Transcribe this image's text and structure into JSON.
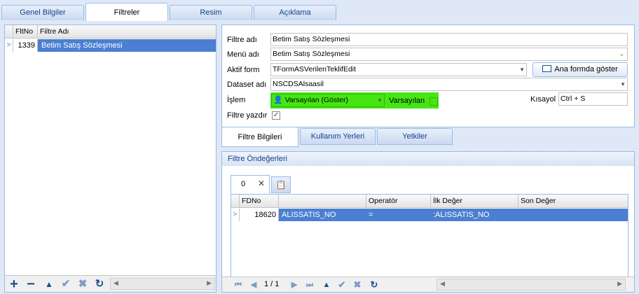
{
  "top_tabs": [
    "Genel Bilgiler",
    "Filtreler",
    "Resim",
    "Açıklama"
  ],
  "left_grid": {
    "headers": [
      "FltNo",
      "Filtre Adı"
    ],
    "rows": [
      {
        "no": "1339",
        "name": "Betim Satış Sözleşmesi"
      }
    ]
  },
  "form": {
    "filtre_adi_label": "Filtre adı",
    "filtre_adi": "Betim Satış Sözleşmesi",
    "menu_adi_label": "Menü adı",
    "menu_adi": "Betim Satış Sözleşmesi",
    "aktif_form_label": "Aktif form",
    "aktif_form": "TFormASVerilenTeklifEdit",
    "ana_forma_label": "Ana formda göster",
    "dataset_label": "Dataset adı",
    "dataset": "NSCDSAlsaasil",
    "islem_label": "İşlem",
    "islem": "Varsayılan (Göster)",
    "varsayilan_label": "Varsayılan",
    "kisayol_label": "Kısayol",
    "kisayol": "Ctrl + S",
    "filtre_yazdir_label": "Filtre yazdır"
  },
  "sub_tabs": [
    "Filtre Bilgileri",
    "Kullanım Yerleri",
    "Yetkiler"
  ],
  "group_title": "Filtre Öndeğerleri",
  "inner_tab": "0",
  "grid2": {
    "headers": [
      "FDNo",
      "",
      "Operatör",
      "İlk Değer",
      "Son Değer"
    ],
    "rows": [
      {
        "fdno": "18620",
        "field": "ALISSATIS_NO",
        "op": "=",
        "ilk": ":ALISSATIS_NO",
        "son": ""
      }
    ]
  },
  "pager": "1 / 1",
  "colors": {
    "accent": "#4b7fd1",
    "highlight": "#46e614",
    "border": "#99bbe8"
  }
}
